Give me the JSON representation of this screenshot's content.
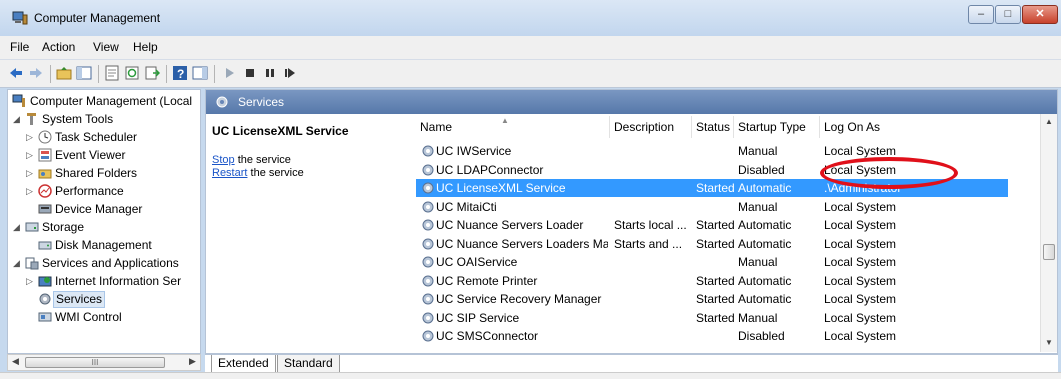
{
  "window": {
    "title": "Computer Management",
    "min_glyph": "–",
    "max_glyph": "□",
    "close_glyph": "✕"
  },
  "menu": [
    "File",
    "Action",
    "View",
    "Help"
  ],
  "tree": {
    "root": "Computer Management (Local",
    "system_tools": "System Tools",
    "task_scheduler": "Task Scheduler",
    "event_viewer": "Event Viewer",
    "shared_folders": "Shared Folders",
    "performance": "Performance",
    "device_manager": "Device Manager",
    "storage": "Storage",
    "disk_management": "Disk Management",
    "services_apps": "Services and Applications",
    "iis": "Internet Information Ser",
    "services": "Services",
    "wmi": "WMI Control",
    "scroll_grip": "III"
  },
  "main": {
    "header": "Services",
    "selected_service": "UC LicenseXML Service",
    "stop_link": "Stop",
    "stop_rest": " the service",
    "restart_link": "Restart",
    "restart_rest": " the service"
  },
  "columns": {
    "name": "Name",
    "description": "Description",
    "status": "Status",
    "startup_type": "Startup Type",
    "log_on_as": "Log On As"
  },
  "rows": [
    {
      "name": "UC IWService",
      "description": "",
      "status": "",
      "startup": "Manual",
      "logon": "Local System"
    },
    {
      "name": "UC LDAPConnector",
      "description": "",
      "status": "",
      "startup": "Disabled",
      "logon": "Local System"
    },
    {
      "name": "UC LicenseXML Service",
      "description": "",
      "status": "Started",
      "startup": "Automatic",
      "logon": ".\\Administrator"
    },
    {
      "name": "UC MitaiCti",
      "description": "",
      "status": "",
      "startup": "Manual",
      "logon": "Local System"
    },
    {
      "name": "UC Nuance Servers Loader",
      "description": "Starts local ...",
      "status": "Started",
      "startup": "Automatic",
      "logon": "Local System"
    },
    {
      "name": "UC Nuance Servers Loaders Ma...",
      "description": "Starts and ...",
      "status": "Started",
      "startup": "Automatic",
      "logon": "Local System"
    },
    {
      "name": "UC OAIService",
      "description": "",
      "status": "",
      "startup": "Manual",
      "logon": "Local System"
    },
    {
      "name": "UC Remote Printer",
      "description": "",
      "status": "Started",
      "startup": "Automatic",
      "logon": "Local System"
    },
    {
      "name": "UC Service Recovery Manager",
      "description": "",
      "status": "Started",
      "startup": "Automatic",
      "logon": "Local System"
    },
    {
      "name": "UC SIP Service",
      "description": "",
      "status": "Started",
      "startup": "Manual",
      "logon": "Local System"
    },
    {
      "name": "UC SMSConnector",
      "description": "",
      "status": "",
      "startup": "Disabled",
      "logon": "Local System"
    }
  ],
  "tabs": {
    "extended": "Extended",
    "standard": "Standard"
  },
  "colors": {
    "selection": "#3399ff",
    "header": "#6887b8",
    "annotation": "#e0101a"
  }
}
